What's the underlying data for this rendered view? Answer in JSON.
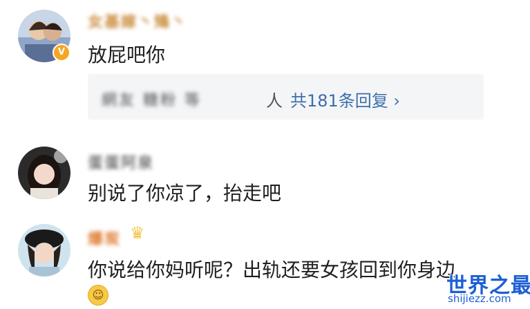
{
  "comments": [
    {
      "username": "女基嫁丶鴙丶",
      "text": "放屁吧你",
      "verified_badge": "V",
      "reply": {
        "blurred_names": "網友 糖粉 等",
        "people_suffix": "人",
        "link_label": "共181条回复 ›"
      }
    },
    {
      "username": "蛋蛋阿泉",
      "text": "别说了你凉了，抬走吧"
    },
    {
      "username": "爆炭",
      "text": "你说给你妈听呢？出轨还要女孩回到你身边",
      "emoji": "shy-face-emoji"
    }
  ],
  "watermark": {
    "title": "世界之最",
    "domain": "shijiezz.com"
  },
  "colors": {
    "link": "#3d6ea9",
    "reply_bg": "#f4f5f7",
    "verified": "#f5a623",
    "watermark": "#1d5fd6"
  }
}
